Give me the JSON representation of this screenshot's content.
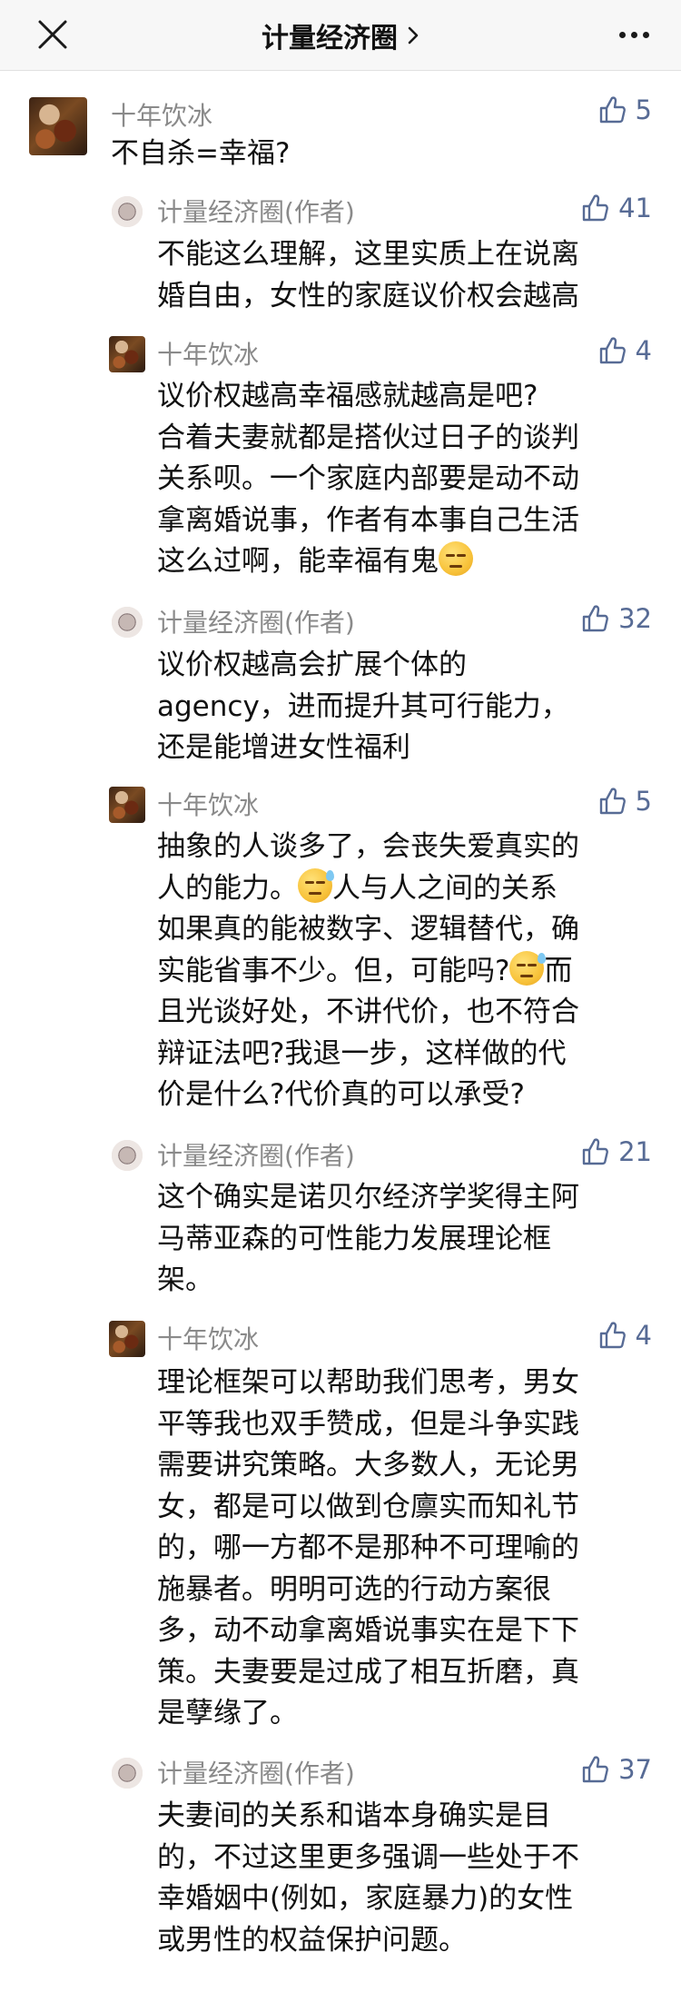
{
  "header": {
    "title": "计量经济圈",
    "close_icon": "close-icon",
    "more_icon": "more-dots-icon",
    "chevron_icon": "chevron-right-icon"
  },
  "main_comment": {
    "author": "十年饮冰",
    "likes": "5",
    "text": "不自杀=幸福?"
  },
  "replies": [
    {
      "author": "计量经济圈(作者)",
      "likes": "41",
      "lines": [
        "不能这么理解，这里实质上在说离",
        "婚自由，女性的家庭议价权会越高"
      ]
    },
    {
      "author": "十年饮冰",
      "likes": "4",
      "lines": [
        "议价权越高幸福感就越高是吧?",
        "合着夫妻就都是搭伙过日子的谈判",
        "关系呗。一个家庭内部要是动不动",
        "拿离婚说事，作者有本事自己生活",
        "这么过啊，能幸福有鬼"
      ]
    },
    {
      "author": "计量经济圈(作者)",
      "likes": "32",
      "lines": [
        "议价权越高会扩展个体的",
        "agency，进而提升其可行能力，",
        "还是能增进女性福利"
      ]
    },
    {
      "author": "十年饮冰",
      "likes": "5",
      "lines": [
        "抽象的人谈多了，会丧失爱真实的",
        "人的能力。",
        "人与人之间的关系",
        "如果真的能被数字、逻辑替代，确",
        "实能省事不少。但，可能吗?",
        "而",
        "且光谈好处，不讲代价，也不符合",
        "辩证法吧?我退一步，这样做的代",
        "价是什么?代价真的可以承受?"
      ]
    },
    {
      "author": "计量经济圈(作者)",
      "likes": "21",
      "lines": [
        "这个确实是诺贝尔经济学奖得主阿",
        "马蒂亚森的可性能力发展理论框",
        "架。"
      ]
    },
    {
      "author": "十年饮冰",
      "likes": "4",
      "lines": [
        "理论框架可以帮助我们思考，男女",
        "平等我也双手赞成，但是斗争实践",
        "需要讲究策略。大多数人，无论男",
        "女，都是可以做到仓廪实而知礼节",
        "的，哪一方都不是那种不可理喻的",
        "施暴者。明明可选的行动方案很",
        "多，动不动拿离婚说事实在是下下",
        "策。夫妻要是过成了相互折磨，真",
        "是孽缘了。"
      ]
    },
    {
      "author": "计量经济圈(作者)",
      "likes": "37",
      "lines": [
        "夫妻间的关系和谐本身确实是目",
        "的，不过这里更多强调一些处于不",
        "幸婚姻中(例如，家庭暴力)的女性",
        "或男性的权益保护问题。"
      ]
    }
  ],
  "colors": {
    "like_blue": "#576b95",
    "name_gray": "#8a8a8a",
    "text": "#111111",
    "header_bg": "#f7f7f7"
  }
}
